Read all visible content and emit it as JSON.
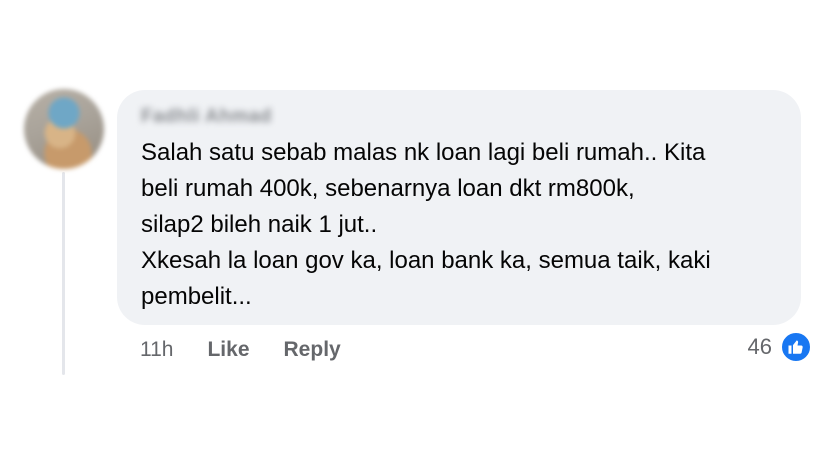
{
  "comment": {
    "author_name": "Fadhli Ahmad",
    "text_lines": [
      "Salah satu sebab malas nk loan lagi beli rumah.. Kita",
      "beli rumah 400k, sebenarnya loan dkt rm800k,",
      "silap2 bileh naik 1 jut..",
      "Xkesah la loan gov ka, loan bank ka, semua taik, kaki",
      "pembelit..."
    ],
    "timestamp": "11h",
    "like_label": "Like",
    "reply_label": "Reply",
    "reaction_count": "46",
    "reaction_icon": "like-thumb-icon",
    "colors": {
      "bubble": "#f0f2f5",
      "meta_text": "#65676b",
      "body_text": "#050505",
      "like_badge": "#1877f2"
    }
  }
}
